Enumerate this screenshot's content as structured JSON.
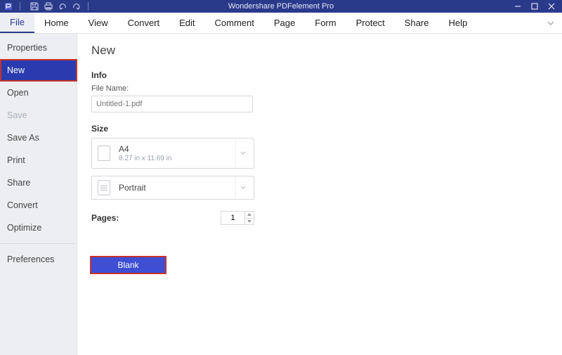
{
  "titlebar": {
    "app_title": "Wondershare PDFelement Pro"
  },
  "menubar": {
    "items": [
      "File",
      "Home",
      "View",
      "Convert",
      "Edit",
      "Comment",
      "Page",
      "Form",
      "Protect",
      "Share",
      "Help"
    ],
    "active_index": 0
  },
  "sidebar": {
    "items": [
      {
        "label": "Properties",
        "state": "normal"
      },
      {
        "label": "New",
        "state": "selected"
      },
      {
        "label": "Open",
        "state": "normal"
      },
      {
        "label": "Save",
        "state": "disabled"
      },
      {
        "label": "Save As",
        "state": "normal"
      },
      {
        "label": "Print",
        "state": "normal"
      },
      {
        "label": "Share",
        "state": "normal"
      },
      {
        "label": "Convert",
        "state": "normal"
      },
      {
        "label": "Optimize",
        "state": "normal"
      },
      {
        "label": "Preferences",
        "state": "normal"
      }
    ]
  },
  "main": {
    "heading": "New",
    "info_label": "Info",
    "file_name_label": "File Name:",
    "file_name_placeholder": "Untitled-1.pdf",
    "size_label": "Size",
    "paper": {
      "name": "A4",
      "dims": "8.27 in x 11.69 in"
    },
    "orientation": "Portrait",
    "pages_label": "Pages:",
    "pages_value": "1",
    "blank_button": "Blank"
  }
}
